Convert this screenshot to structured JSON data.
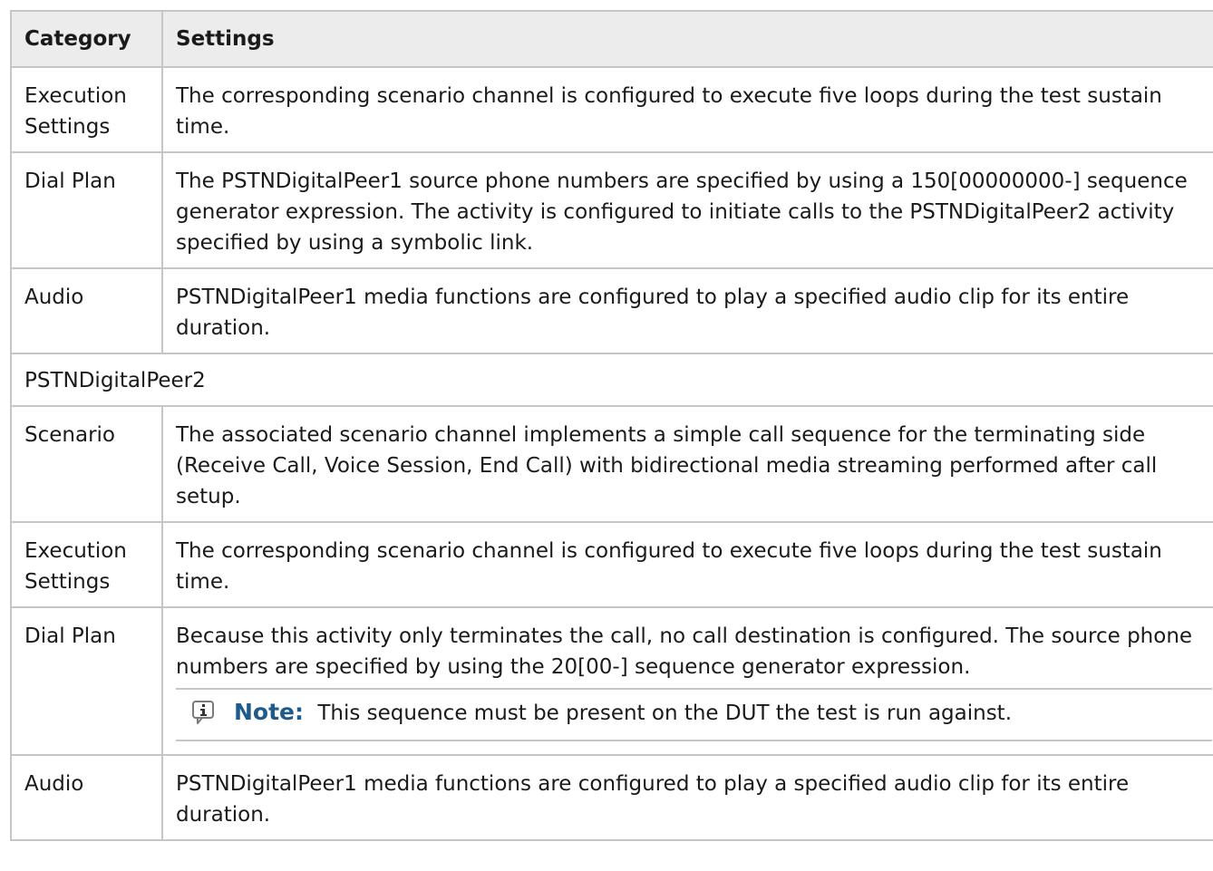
{
  "table": {
    "headers": {
      "category": "Category",
      "settings": "Settings"
    },
    "rows": [
      {
        "category": "Execution Settings",
        "settings": "The corresponding scenario channel is configured to execute five loops during the test sustain time."
      },
      {
        "category": "Dial Plan",
        "settings": "The PSTNDigitalPeer1 source phone numbers are specified by using a 150[00000000-] sequence generator expression. The activity is configured to initiate calls to the PSTNDigitalPeer2 activity specified by using a symbolic link."
      },
      {
        "category": "Audio",
        "settings": "PSTNDigitalPeer1 media functions are configured to play a specified audio clip for its entire duration."
      },
      {
        "section": "PSTNDigitalPeer2"
      },
      {
        "category": "Scenario",
        "settings": "The associated scenario channel implements a simple call sequence for the terminating side (Receive Call, Voice Session, End Call) with bidirectional media streaming performed after call setup."
      },
      {
        "category": "Execution Settings",
        "settings": "The corresponding scenario channel is configured to execute five loops during the test sustain time."
      },
      {
        "category": "Dial Plan",
        "settings": "Because this activity only terminates the call, no call destination is configured. The source phone numbers are specified by using the 20[00-] sequence generator expression.",
        "note_label": "Note:",
        "note_text": "This sequence must be present on the DUT the test is run against.",
        "note_icon": "info-icon"
      },
      {
        "category": "Audio",
        "settings": "PSTNDigitalPeer1 media functions are configured to play a specified audio clip for its entire duration."
      }
    ]
  },
  "colors": {
    "header_bg": "#ececec",
    "border": "#c6c6c6",
    "note_label": "#1f5a8c"
  }
}
